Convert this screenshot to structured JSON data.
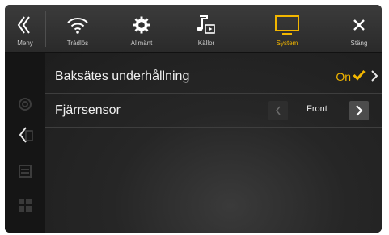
{
  "topbar": {
    "items": [
      {
        "label": "Meny",
        "icon": "back-chevron-icon"
      },
      {
        "label": "Trådlös",
        "icon": "wifi-icon"
      },
      {
        "label": "Allmänt",
        "icon": "gear-icon"
      },
      {
        "label": "Källor",
        "icon": "music-source-icon"
      },
      {
        "label": "System",
        "icon": "monitor-icon",
        "active": true
      },
      {
        "label": "Stäng",
        "icon": "close-icon"
      }
    ]
  },
  "settings": {
    "rear_entertainment": {
      "label": "Baksätes underhållning",
      "value": "On"
    },
    "remote_sensor": {
      "label": "Fjärrsensor",
      "value": "Front"
    }
  },
  "colors": {
    "accent": "#f2b600",
    "background": "#1b1b1b",
    "topbar": "#333333"
  }
}
